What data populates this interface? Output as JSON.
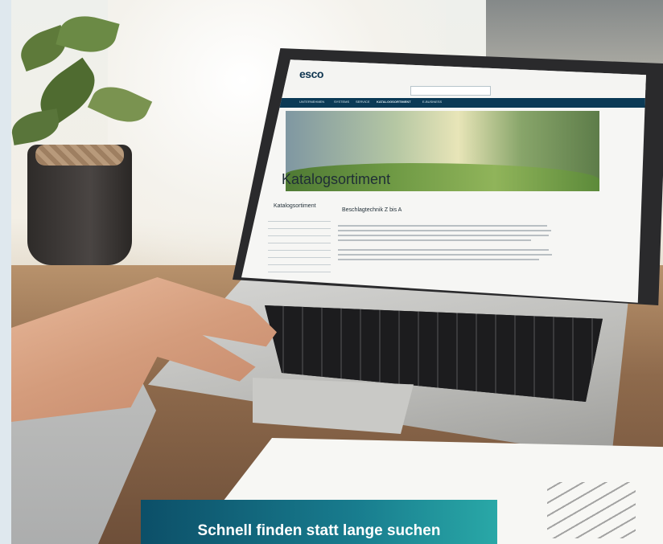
{
  "website_on_screen": {
    "logo": "esco",
    "tagline": "",
    "search_placeholder": "",
    "nav": [
      "UNTERNEHMEN",
      "SYSTEMS",
      "SERVICE",
      "KATALOGSORTIMENT",
      "E-BUSINESS"
    ],
    "hero_title": "Katalogsortiment",
    "sidebar_title": "Katalogsortiment",
    "content_title": "Beschlagtechnik Z bis A"
  },
  "caption": {
    "text": "Schnell finden statt lange suchen"
  }
}
